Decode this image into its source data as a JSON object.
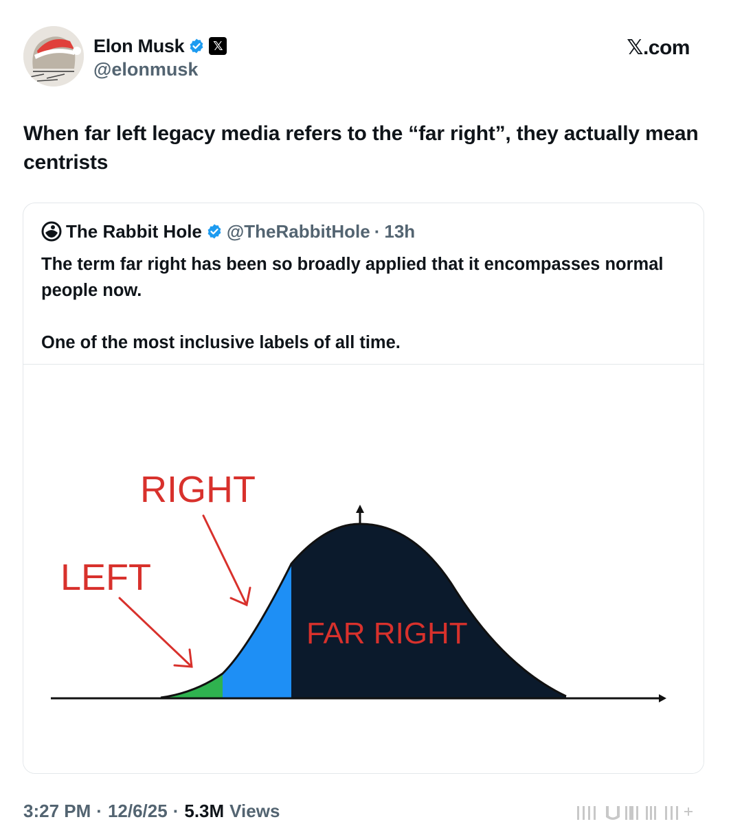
{
  "author": {
    "display_name": "Elon Musk",
    "handle": "@elonmusk",
    "avatar_icon": "avatar-santa-hat",
    "verified_icon": "verified-badge-icon",
    "affiliation_icon": "x-logo-icon",
    "affiliation_glyph": "𝕏"
  },
  "site_label": "𝕏.com",
  "tweet_text": "When far left legacy media refers to the “far right”, they actually mean centrists",
  "quote": {
    "display_name": "The Rabbit Hole",
    "handle": "@TheRabbitHole",
    "separator": "·",
    "time": "13h",
    "avatar_icon": "rabbit-hole-icon",
    "body": [
      "The term far right has been so broadly applied that it encompasses normal people now.",
      "One of the most inclusive labels of all time."
    ],
    "image": {
      "labels": {
        "left": "LEFT",
        "right": "RIGHT",
        "far_right": "FAR RIGHT"
      },
      "colors": {
        "left": "#2fb24f",
        "right": "#1e8ff5",
        "far_right": "#0b1a2c",
        "label_red": "#d8312c"
      }
    }
  },
  "footer": {
    "time": "3:27 PM",
    "date": "12/6/25",
    "views_count": "5.3M",
    "views_label": "Views",
    "separator": "·"
  },
  "colors": {
    "text_primary": "#0f1419",
    "text_secondary": "#536471",
    "verified_blue": "#1d9bf0",
    "border": "#e3e7ea"
  }
}
